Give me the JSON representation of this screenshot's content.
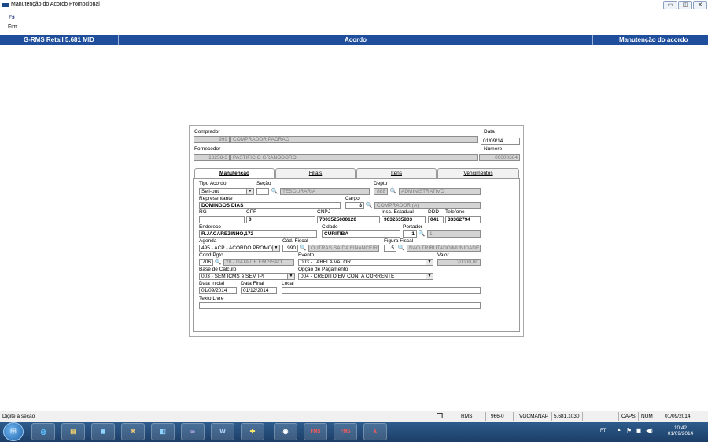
{
  "window": {
    "title": "Manutenção do Acordo Promocional",
    "min": "▭",
    "max": "◫",
    "close": "✕"
  },
  "toolbar": {
    "f3": "F3",
    "fim": "Fim"
  },
  "header": {
    "left": "G-RMS Retail 5.681 MID",
    "center": "Acordo",
    "right": "Manutenção do acordo"
  },
  "form": {
    "comprador_label": "Comprador",
    "comprador_code": "999",
    "comprador_name": "COMPRADOR PADRAO",
    "data_label": "Data",
    "data_value": "01/09/14",
    "fornecedor_label": "Fornecedor",
    "fornecedor_code": "18258-3",
    "fornecedor_name": "PASTIFICIO GRANODORO",
    "numero_label": "Numero",
    "numero_value": "00000364"
  },
  "tabs": [
    {
      "label": "Manutenção"
    },
    {
      "label": "Filiais"
    },
    {
      "label": "Itens"
    },
    {
      "label": "Vencimentos"
    }
  ],
  "details": {
    "tipo_acordo_label": "Tipo Acordo",
    "tipo_acordo_value": "Sell-out",
    "secao_label": "Seção",
    "secao_value": "",
    "secao_desc": "TESOURARIA",
    "depto_label": "Depto",
    "depto_code": "888",
    "depto_desc": "ADMINISTRATIVO",
    "representante_label": "Representante",
    "representante_value": "DOMINGOS DIAS",
    "cargo_label": "Cargo",
    "cargo_code": "8",
    "cargo_desc": "COMPRADOR (A)",
    "rg_label": "RG",
    "rg_value": "",
    "cpf_label": "CPF",
    "cpf_value": "0",
    "cnpj_label": "CNPJ",
    "cnpj_value": "7003525000120",
    "insc_label": "Insc. Estadual",
    "insc_value": "9032635803",
    "ddd_label": "DDD",
    "ddd_value": "041",
    "telefone_label": "Telefone",
    "telefone_value": "33362794",
    "endereco_label": "Endereco",
    "endereco_value": "R.JACAREZINHO,172",
    "cidade_label": "Cidade",
    "cidade_value": "CURITIBA",
    "portador_label": "Portador",
    "portador_code": "1",
    "portador_desc": "1",
    "agenda_label": "Agenda",
    "agenda_value": "495 - ACP - ACORDO PROMO",
    "codfiscal_label": "Cód. Fiscal",
    "codfiscal_code": "990",
    "codfiscal_desc": "OUTRAS SAIDA FINANCEIRA",
    "figura_label": "Figura Fiscal",
    "figura_code": "5",
    "figura_desc": "NAO TRIBUTADO/MUNIDADE",
    "condpgto_label": "Cond.Pgto",
    "condpgto_code": "706",
    "condpgto_desc": "28 - DATA DE EMISSAO",
    "evento_label": "Evento",
    "evento_value": "003 - TABELA VALOR",
    "valor_label": "Valor",
    "valor_value": "20000,00",
    "base_label": "Base de Cálculo",
    "base_value": "003 - SEM ICMS e SEM IPI",
    "opcao_label": "Opção de Pagamento",
    "opcao_value": "004 - CRÉDITO EM CONTA CORRENTE",
    "datainicial_label": "Data Inicial",
    "datainicial_value": "01/09/2014",
    "datafinal_label": "Data Final",
    "datafinal_value": "01/12/2014",
    "local_label": "Local",
    "local_value": "",
    "texto_label": "Texto Livre",
    "texto_value": ""
  },
  "status": {
    "message": "Digite a seção",
    "rms": "RMS",
    "code": "966-0",
    "user": "VGCMANAP",
    "version": "5.681.1030",
    "caps": "CAPS",
    "num": "NUM",
    "date": "01/09/2014"
  },
  "taskbar": {
    "fms1": "FMS",
    "fms2": "FMS",
    "tray_ft": "FT",
    "time": "10:42",
    "date": "01/09/2014"
  },
  "colors": {
    "header_blue": "#1f4e9c",
    "readonly_gray": "#d4d4d4",
    "taskbar": "#1c3e66"
  }
}
